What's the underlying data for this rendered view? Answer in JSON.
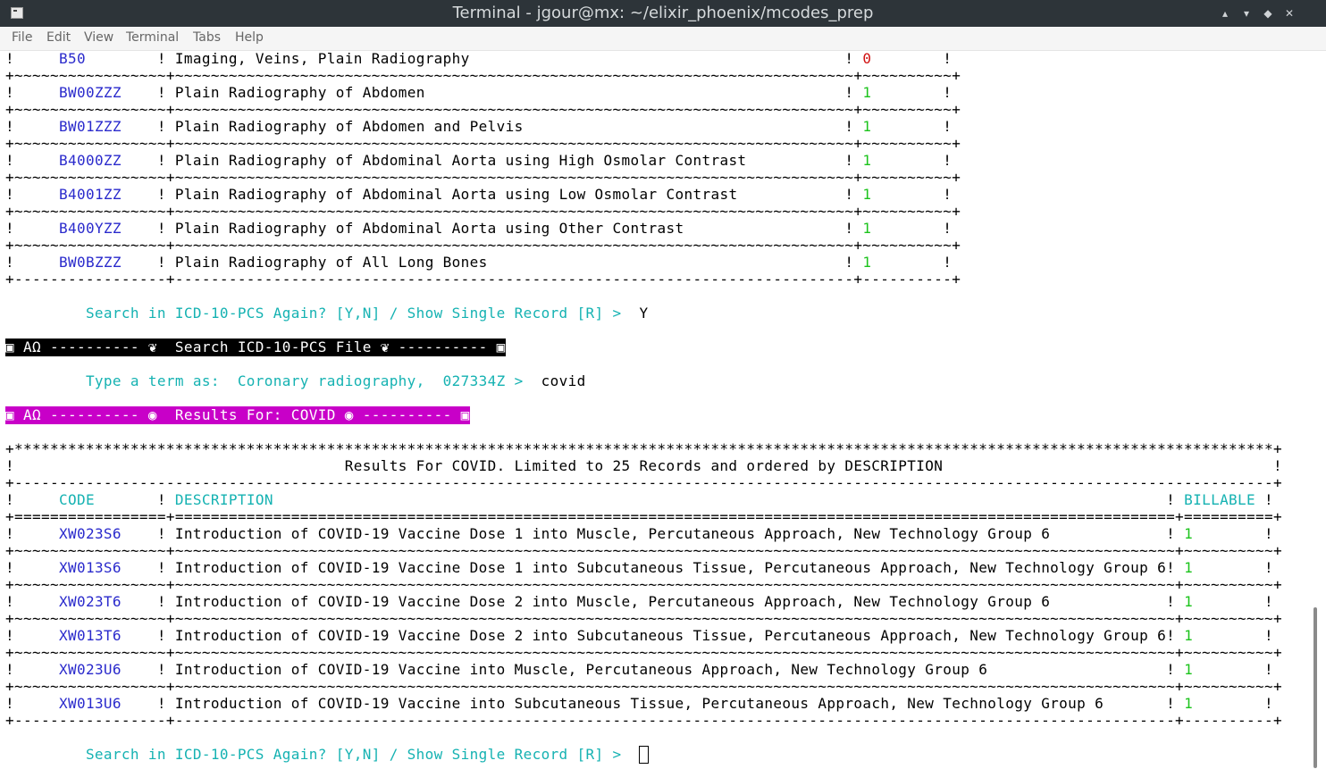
{
  "window": {
    "title": "Terminal - jgour@mx: ~/elixir_phoenix/mcodes_prep",
    "buttons": [
      "▴",
      "▾",
      "◆",
      "✕"
    ]
  },
  "menu": [
    "File",
    "Edit",
    "View",
    "Terminal",
    "Tabs",
    "Help"
  ],
  "top_table": {
    "rows": [
      {
        "code": "B50",
        "desc": "Imaging, Veins, Plain Radiography",
        "billable": "0"
      },
      {
        "code": "BW00ZZZ",
        "desc": "Plain Radiography of Abdomen",
        "billable": "1"
      },
      {
        "code": "BW01ZZZ",
        "desc": "Plain Radiography of Abdomen and Pelvis",
        "billable": "1"
      },
      {
        "code": "B4000ZZ",
        "desc": "Plain Radiography of Abdominal Aorta using High Osmolar Contrast",
        "billable": "1"
      },
      {
        "code": "B4001ZZ",
        "desc": "Plain Radiography of Abdominal Aorta using Low Osmolar Contrast",
        "billable": "1"
      },
      {
        "code": "B400YZZ",
        "desc": "Plain Radiography of Abdominal Aorta using Other Contrast",
        "billable": "1"
      },
      {
        "code": "BW0BZZZ",
        "desc": "Plain Radiography of All Long Bones",
        "billable": "1"
      }
    ]
  },
  "prompt1": {
    "text": "Search in ICD-10-PCS Again? [Y,N] / Show Single Record [R] >",
    "answer": "Y"
  },
  "banner_search": "▣ AΩ ---------- ❦  Search ICD-10-PCS File ❦ ---------- ▣",
  "prompt2": {
    "text": "Type a term as:  Coronary radiography,  027334Z >",
    "answer": "covid"
  },
  "banner_results": "▣ AΩ ---------- ◉  Results For: COVID ◉ ---------- ▣",
  "results": {
    "heading": "Results For COVID. Limited to 25 Records and ordered by DESCRIPTION",
    "col_code": "CODE",
    "col_desc": "DESCRIPTION",
    "col_bill": "BILLABLE",
    "rows": [
      {
        "code": "XW023S6",
        "desc": "Introduction of COVID-19 Vaccine Dose 1 into Muscle, Percutaneous Approach, New Technology Group 6",
        "billable": "1"
      },
      {
        "code": "XW013S6",
        "desc": "Introduction of COVID-19 Vaccine Dose 1 into Subcutaneous Tissue, Percutaneous Approach, New Technology Group 6",
        "billable": "1"
      },
      {
        "code": "XW023T6",
        "desc": "Introduction of COVID-19 Vaccine Dose 2 into Muscle, Percutaneous Approach, New Technology Group 6",
        "billable": "1"
      },
      {
        "code": "XW013T6",
        "desc": "Introduction of COVID-19 Vaccine Dose 2 into Subcutaneous Tissue, Percutaneous Approach, New Technology Group 6",
        "billable": "1"
      },
      {
        "code": "XW023U6",
        "desc": "Introduction of COVID-19 Vaccine into Muscle, Percutaneous Approach, New Technology Group 6",
        "billable": "1"
      },
      {
        "code": "XW013U6",
        "desc": "Introduction of COVID-19 Vaccine into Subcutaneous Tissue, Percutaneous Approach, New Technology Group 6",
        "billable": "1"
      }
    ]
  },
  "prompt3": {
    "text": "Search in ICD-10-PCS Again? [Y,N] / Show Single Record [R] >",
    "answer": ""
  }
}
